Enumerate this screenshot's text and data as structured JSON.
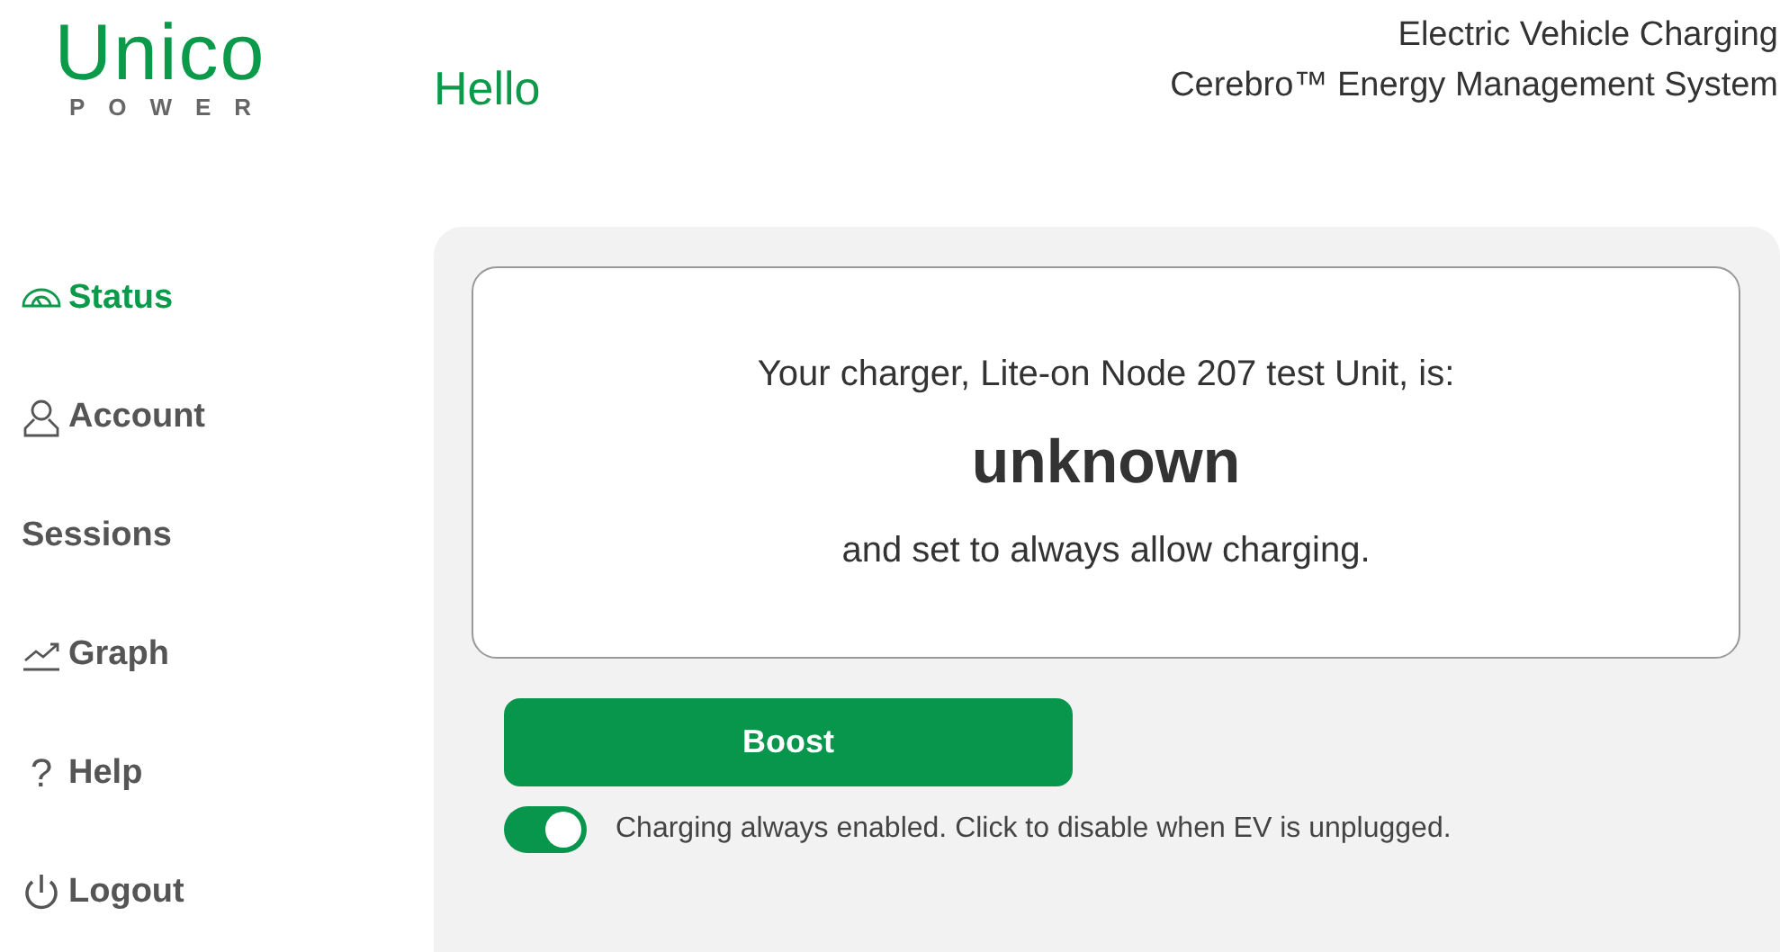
{
  "logo": {
    "name": "Unico",
    "tagline": "POWER"
  },
  "greeting": "Hello",
  "header_lines": [
    "Electric Vehicle Charging",
    "Cerebro™ Energy Management System"
  ],
  "sidebar": {
    "items": [
      {
        "label": "Status",
        "selected": true
      },
      {
        "label": "Account",
        "selected": false
      },
      {
        "label": "Sessions",
        "selected": false
      },
      {
        "label": "Graph",
        "selected": false
      },
      {
        "label": "Help",
        "glyph": "?",
        "selected": false
      },
      {
        "label": "Logout",
        "selected": false
      }
    ]
  },
  "status_card": {
    "intro": "Your charger, Lite-on Node 207 test Unit, is:",
    "state": "unknown",
    "detail": "and set to always allow charging."
  },
  "boost_button": "Boost",
  "charging_toggle": {
    "on": true,
    "label": "Charging always enabled. Click to disable when EV is unplugged."
  }
}
